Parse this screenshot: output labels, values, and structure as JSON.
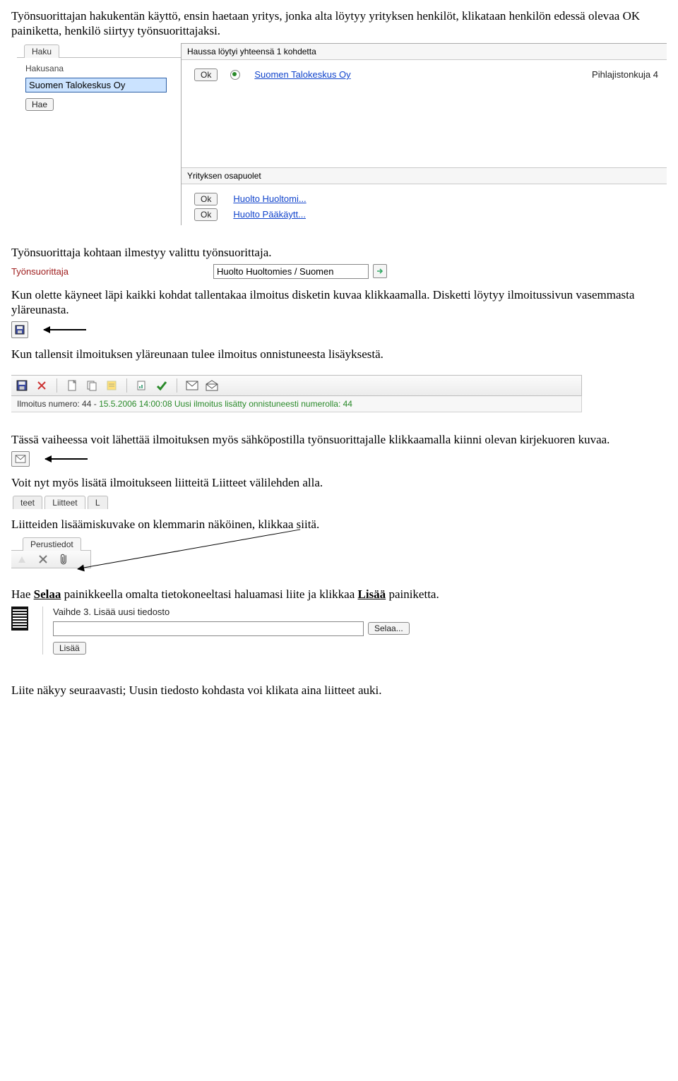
{
  "paragraphs": {
    "p1": "Työnsuorittajan hakukentän käyttö, ensin haetaan yritys, jonka alta löytyy yrityksen henkilöt, klikataan henkilön edessä olevaa OK painiketta, henkilö siirtyy työnsuorittajaksi.",
    "p2": "Työnsuorittaja kohtaan ilmestyy valittu työnsuorittaja.",
    "p3": "Kun olette käyneet läpi kaikki kohdat tallentakaa ilmoitus disketin kuvaa klikkaamalla. Disketti löytyy ilmoitussivun vasemmasta yläreunasta.",
    "p4": "Kun tallensit ilmoituksen yläreunaan tulee ilmoitus onnistuneesta lisäyksestä.",
    "p5": "Tässä vaiheessa voit lähettää ilmoituksen myös sähköpostilla työnsuorittajalle klikkaamalla kiinni olevan kirjekuoren kuvaa.",
    "p6": "Voit nyt myös lisätä ilmoitukseen liitteitä Liitteet välilehden alla.",
    "p7": "Liitteiden lisäämiskuvake on klemmarin näköinen, klikkaa siitä.",
    "p8a": "Hae ",
    "p8_selaa": "Selaa",
    "p8b": " painikkeella omalta tietokoneeltasi haluamasi liite ja klikkaa ",
    "p8_lisaa": "Lisää",
    "p8c": " painiketta.",
    "p9": "Liite näkyy seuraavasti; Uusin tiedosto kohdasta voi klikata aina liitteet auki."
  },
  "search_panel": {
    "tab": "Haku",
    "label_keyword": "Hakusana",
    "input_value": "Suomen Talokeskus Oy",
    "search_btn": "Hae",
    "results_header": "Haussa löytyi yhteensä 1 kohdetta",
    "ok_btn": "Ok",
    "result_link": "Suomen Talokeskus Oy",
    "result_addr": "Pihlajistonkuja 4",
    "parties_header": "Yrityksen osapuolet",
    "party1": "Huolto Huoltomi...",
    "party2": "Huolto Pääkäytt..."
  },
  "performer_row": {
    "label": "Työnsuorittaja",
    "value": "Huolto Huoltomies / Suomen"
  },
  "toolbar_status": {
    "prefix": "Ilmoitus numero: ",
    "number": "44",
    "dash": " - ",
    "msg": "15.5.2006 14:00:08 Uusi ilmoitus lisätty onnistuneesti numerolla: 44"
  },
  "tabs_row": {
    "t1": "teet",
    "t2": "Liitteet",
    "t3": "L"
  },
  "perustiedot_tab": "Perustiedot",
  "upload_panel": {
    "step": "Vaihde 3. Lisää uusi tiedosto",
    "browse": "Selaa...",
    "add": "Lisää"
  }
}
